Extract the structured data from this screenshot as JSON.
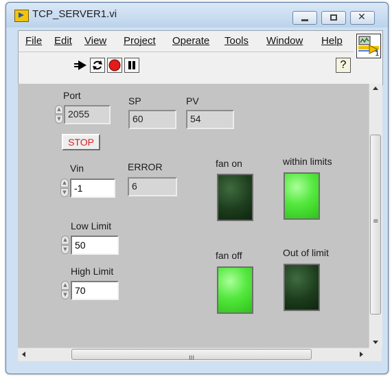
{
  "window": {
    "title": "TCP_SERVER1.vi",
    "controls": [
      "minimize",
      "maximize",
      "close"
    ]
  },
  "menubar": {
    "items": [
      "File",
      "Edit",
      "View",
      "Project",
      "Operate",
      "Tools",
      "Window",
      "Help"
    ]
  },
  "toolbar": {
    "buttons": [
      "run-arrow-icon",
      "run-continuously-icon",
      "abort-icon",
      "pause-icon"
    ],
    "help_label": "?",
    "vi_icon_number": "1"
  },
  "panel": {
    "port": {
      "label": "Port",
      "value": "2055"
    },
    "sp": {
      "label": "SP",
      "value": "60"
    },
    "pv": {
      "label": "PV",
      "value": "54"
    },
    "stop": {
      "label": "STOP"
    },
    "vin": {
      "label": "Vin",
      "value": "-1"
    },
    "error": {
      "label": "ERROR",
      "value": "6"
    },
    "low_limit": {
      "label": "Low Limit",
      "value": "50"
    },
    "high_limit": {
      "label": "High Limit",
      "value": "70"
    },
    "fan_on": {
      "label": "fan on",
      "state": false
    },
    "fan_off": {
      "label": "fan off",
      "state": true
    },
    "within_limits": {
      "label": "within limits",
      "state": true
    },
    "out_of_limit": {
      "label": "Out of limit",
      "state": false
    }
  },
  "scrollbar": {
    "hscroll_grip": "III",
    "vscroll_grip": "≡"
  },
  "colors": {
    "led_on": "#55e83f",
    "led_off": "#1d3d1d",
    "stop_text": "#e01b1b"
  }
}
